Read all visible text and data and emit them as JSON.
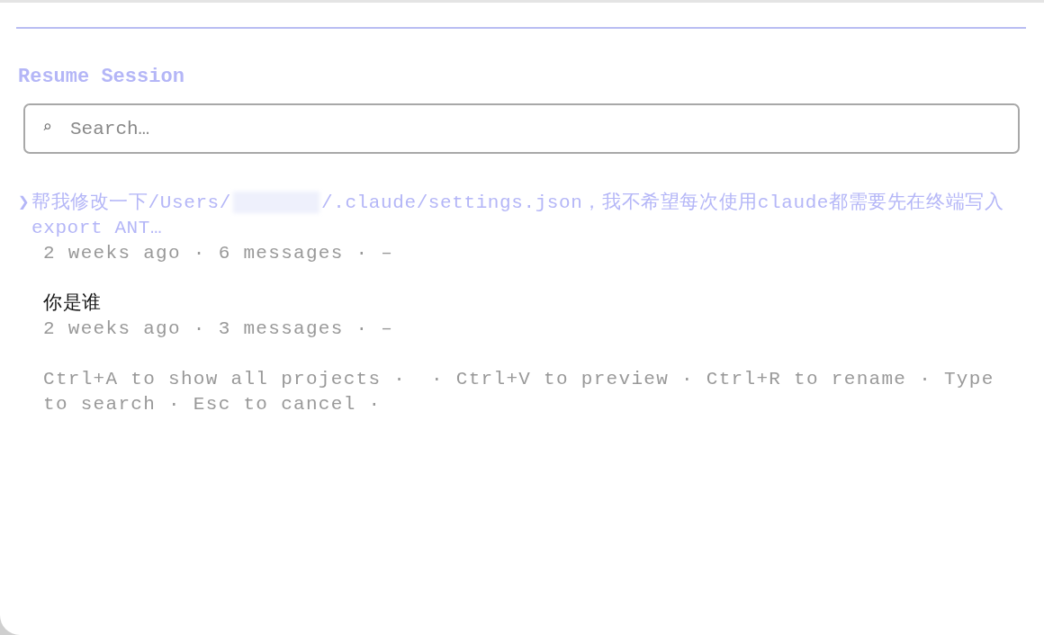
{
  "header": {
    "title": "Resume Session"
  },
  "search": {
    "icon": "⌕",
    "placeholder": "Search…"
  },
  "sessions": [
    {
      "selected": true,
      "pointer": "❯",
      "title_parts": [
        "帮我修改一下/Users/",
        "/.claude/settings.json，我不希望每次使用claude都需要先在终端写入export ANT…"
      ],
      "redacted": true,
      "meta": "2 weeks ago · 6 messages · –"
    },
    {
      "selected": false,
      "title_parts": [
        "你是谁"
      ],
      "redacted": false,
      "meta": "2 weeks ago · 3 messages · –"
    }
  ],
  "hints": "Ctrl+A to show all projects ·  · Ctrl+V to preview · Ctrl+R to rename · Type to search · Esc to cancel ·"
}
